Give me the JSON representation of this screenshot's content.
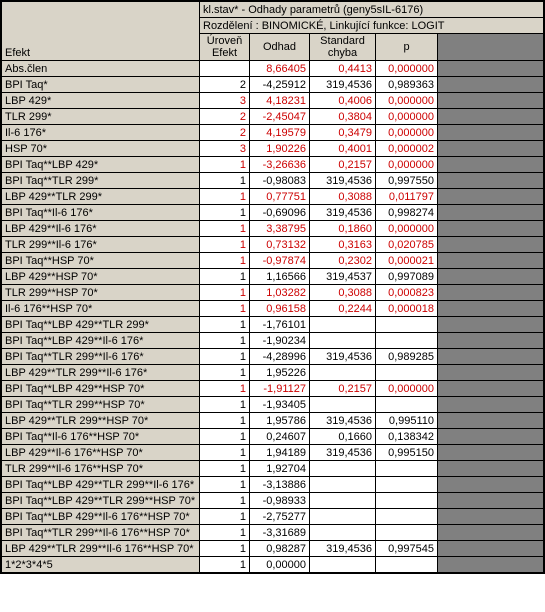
{
  "title_line1": "kl.stav* - Odhady parametrů (geny5sIL-6176)",
  "title_line2": "Rozdělení : BINOMICKÉ, Linkující funkce: LOGIT",
  "corner": "Efekt",
  "columns": {
    "lvl_top": "Úroveň",
    "lvl_bot": "Efekt",
    "est": "Odhad",
    "se_top": "Standard",
    "se_bot": "chyba",
    "p": "p"
  },
  "rows": [
    {
      "label": "Abs.člen",
      "lvl": "",
      "est": "8,66405",
      "se": "0,4413",
      "p": "0,000000",
      "red": true
    },
    {
      "label": "BPI Taq*",
      "lvl": "2",
      "est": "-4,25912",
      "se": "319,4536",
      "p": "0,989363",
      "red": false
    },
    {
      "label": "LBP 429*",
      "lvl": "3",
      "est": "4,18231",
      "se": "0,4006",
      "p": "0,000000",
      "red": true
    },
    {
      "label": "TLR 299*",
      "lvl": "2",
      "est": "-2,45047",
      "se": "0,3804",
      "p": "0,000000",
      "red": true
    },
    {
      "label": "Il-6 176*",
      "lvl": "2",
      "est": "4,19579",
      "se": "0,3479",
      "p": "0,000000",
      "red": true
    },
    {
      "label": "HSP 70*",
      "lvl": "3",
      "est": "1,90226",
      "se": "0,4001",
      "p": "0,000002",
      "red": true
    },
    {
      "label": "BPI Taq**LBP 429*",
      "lvl": "1",
      "est": "-3,26636",
      "se": "0,2157",
      "p": "0,000000",
      "red": true
    },
    {
      "label": "BPI Taq**TLR 299*",
      "lvl": "1",
      "est": "-0,98083",
      "se": "319,4536",
      "p": "0,997550",
      "red": false
    },
    {
      "label": "LBP 429**TLR 299*",
      "lvl": "1",
      "est": "0,77751",
      "se": "0,3088",
      "p": "0,011797",
      "red": true
    },
    {
      "label": "BPI Taq**Il-6 176*",
      "lvl": "1",
      "est": "-0,69096",
      "se": "319,4536",
      "p": "0,998274",
      "red": false
    },
    {
      "label": "LBP 429**Il-6 176*",
      "lvl": "1",
      "est": "3,38795",
      "se": "0,1860",
      "p": "0,000000",
      "red": true
    },
    {
      "label": "TLR 299**Il-6 176*",
      "lvl": "1",
      "est": "0,73132",
      "se": "0,3163",
      "p": "0,020785",
      "red": true
    },
    {
      "label": "BPI Taq**HSP 70*",
      "lvl": "1",
      "est": "-0,97874",
      "se": "0,2302",
      "p": "0,000021",
      "red": true
    },
    {
      "label": "LBP 429**HSP 70*",
      "lvl": "1",
      "est": "1,16566",
      "se": "319,4537",
      "p": "0,997089",
      "red": false
    },
    {
      "label": "TLR 299**HSP 70*",
      "lvl": "1",
      "est": "1,03282",
      "se": "0,3088",
      "p": "0,000823",
      "red": true
    },
    {
      "label": "Il-6 176**HSP 70*",
      "lvl": "1",
      "est": "0,96158",
      "se": "0,2244",
      "p": "0,000018",
      "red": true
    },
    {
      "label": "BPI Taq**LBP 429**TLR 299*",
      "lvl": "1",
      "est": "-1,76101",
      "se": "",
      "p": "",
      "red": false
    },
    {
      "label": "BPI Taq**LBP 429**Il-6 176*",
      "lvl": "1",
      "est": "-1,90234",
      "se": "",
      "p": "",
      "red": false
    },
    {
      "label": "BPI Taq**TLR 299**Il-6 176*",
      "lvl": "1",
      "est": "-4,28996",
      "se": "319,4536",
      "p": "0,989285",
      "red": false
    },
    {
      "label": "LBP 429**TLR 299**Il-6 176*",
      "lvl": "1",
      "est": "1,95226",
      "se": "",
      "p": "",
      "red": false
    },
    {
      "label": "BPI Taq**LBP 429**HSP 70*",
      "lvl": "1",
      "est": "-1,91127",
      "se": "0,2157",
      "p": "0,000000",
      "red": true
    },
    {
      "label": "BPI Taq**TLR 299**HSP 70*",
      "lvl": "1",
      "est": "-1,93405",
      "se": "",
      "p": "",
      "red": false
    },
    {
      "label": "LBP 429**TLR 299**HSP 70*",
      "lvl": "1",
      "est": "1,95786",
      "se": "319,4536",
      "p": "0,995110",
      "red": false
    },
    {
      "label": "BPI Taq**Il-6 176**HSP 70*",
      "lvl": "1",
      "est": "0,24607",
      "se": "0,1660",
      "p": "0,138342",
      "red": false
    },
    {
      "label": "LBP 429**Il-6 176**HSP 70*",
      "lvl": "1",
      "est": "1,94189",
      "se": "319,4536",
      "p": "0,995150",
      "red": false
    },
    {
      "label": "TLR 299**Il-6 176**HSP 70*",
      "lvl": "1",
      "est": "1,92704",
      "se": "",
      "p": "",
      "red": false
    },
    {
      "label": "BPI Taq**LBP 429**TLR 299**Il-6 176*",
      "lvl": "1",
      "est": "-3,13886",
      "se": "",
      "p": "",
      "red": false
    },
    {
      "label": "BPI Taq**LBP 429**TLR 299**HSP 70*",
      "lvl": "1",
      "est": "-0,98933",
      "se": "",
      "p": "",
      "red": false
    },
    {
      "label": "BPI Taq**LBP 429**Il-6 176**HSP 70*",
      "lvl": "1",
      "est": "-2,75277",
      "se": "",
      "p": "",
      "red": false
    },
    {
      "label": "BPI Taq**TLR 299**Il-6 176**HSP 70*",
      "lvl": "1",
      "est": "-3,31689",
      "se": "",
      "p": "",
      "red": false
    },
    {
      "label": "LBP 429**TLR 299**Il-6 176**HSP 70*",
      "lvl": "1",
      "est": "0,98287",
      "se": "319,4536",
      "p": "0,997545",
      "red": false
    },
    {
      "label": "1*2*3*4*5",
      "lvl": "1",
      "est": "0,00000",
      "se": "",
      "p": "",
      "red": false
    }
  ]
}
